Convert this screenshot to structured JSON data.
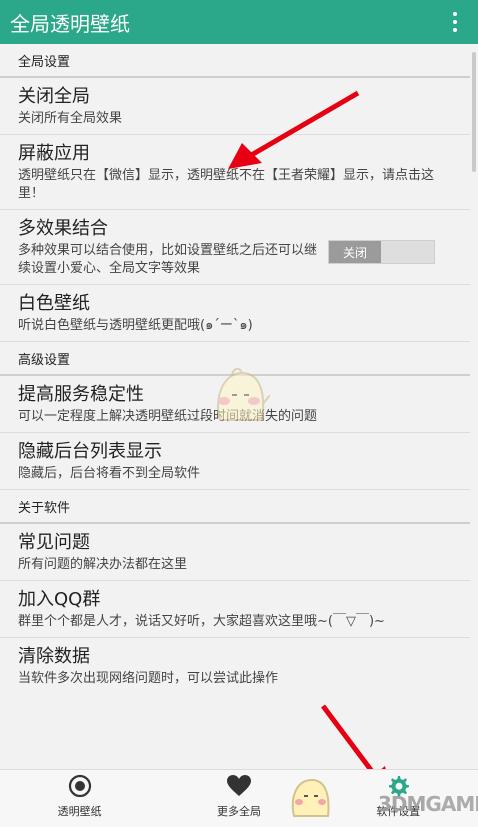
{
  "app": {
    "title": "全局透明壁纸",
    "menu_icon": "more-vert-icon"
  },
  "sections": [
    {
      "header": "全局设置"
    },
    {
      "header": "高级设置"
    },
    {
      "header": "关于软件"
    }
  ],
  "items": {
    "close_global": {
      "title": "关闭全局",
      "desc": "关闭所有全局效果"
    },
    "block_apps": {
      "title": "屏蔽应用",
      "desc": "透明壁纸只在【微信】显示，透明壁纸不在【王者荣耀】显示，请点击这里！"
    },
    "multi_effects": {
      "title": "多效果结合",
      "desc": "多种效果可以结合使用，比如设置壁纸之后还可以继续设置小爱心、全局文字等效果",
      "toggle_label": "关闭",
      "toggle_on": false
    },
    "white_wallpaper": {
      "title": "白色壁纸",
      "desc": "听说白色壁纸与透明壁纸更配哦(๑´ー`๑)"
    },
    "stability": {
      "title": "提高服务稳定性",
      "desc": "可以一定程度上解决透明壁纸过段时间就消失的问题"
    },
    "hide_recents": {
      "title": "隐藏后台列表显示",
      "desc": "隐藏后，后台将看不到全局软件"
    },
    "faq": {
      "title": "常见问题",
      "desc": "所有问题的解决办法都在这里"
    },
    "qq_group": {
      "title": "加入QQ群",
      "desc": "群里个个都是人才，说话又好听，大家超喜欢这里哦~(￣▽￣)~"
    },
    "clear_data": {
      "title": "清除数据",
      "desc": "当软件多次出现网络问题时，可以尝试此操作"
    }
  },
  "bottom_nav": [
    {
      "label": "透明壁纸",
      "icon": "radio-target-icon"
    },
    {
      "label": "更多全局",
      "icon": "heart-icon"
    },
    {
      "label": "软件设置",
      "icon": "gear-icon"
    }
  ],
  "watermark": {
    "brand_a": "3DM",
    "brand_b": "GAME"
  },
  "colors": {
    "appbar": "#2ba889",
    "accent_gear": "#2ba889",
    "arrow": "#e60012"
  }
}
